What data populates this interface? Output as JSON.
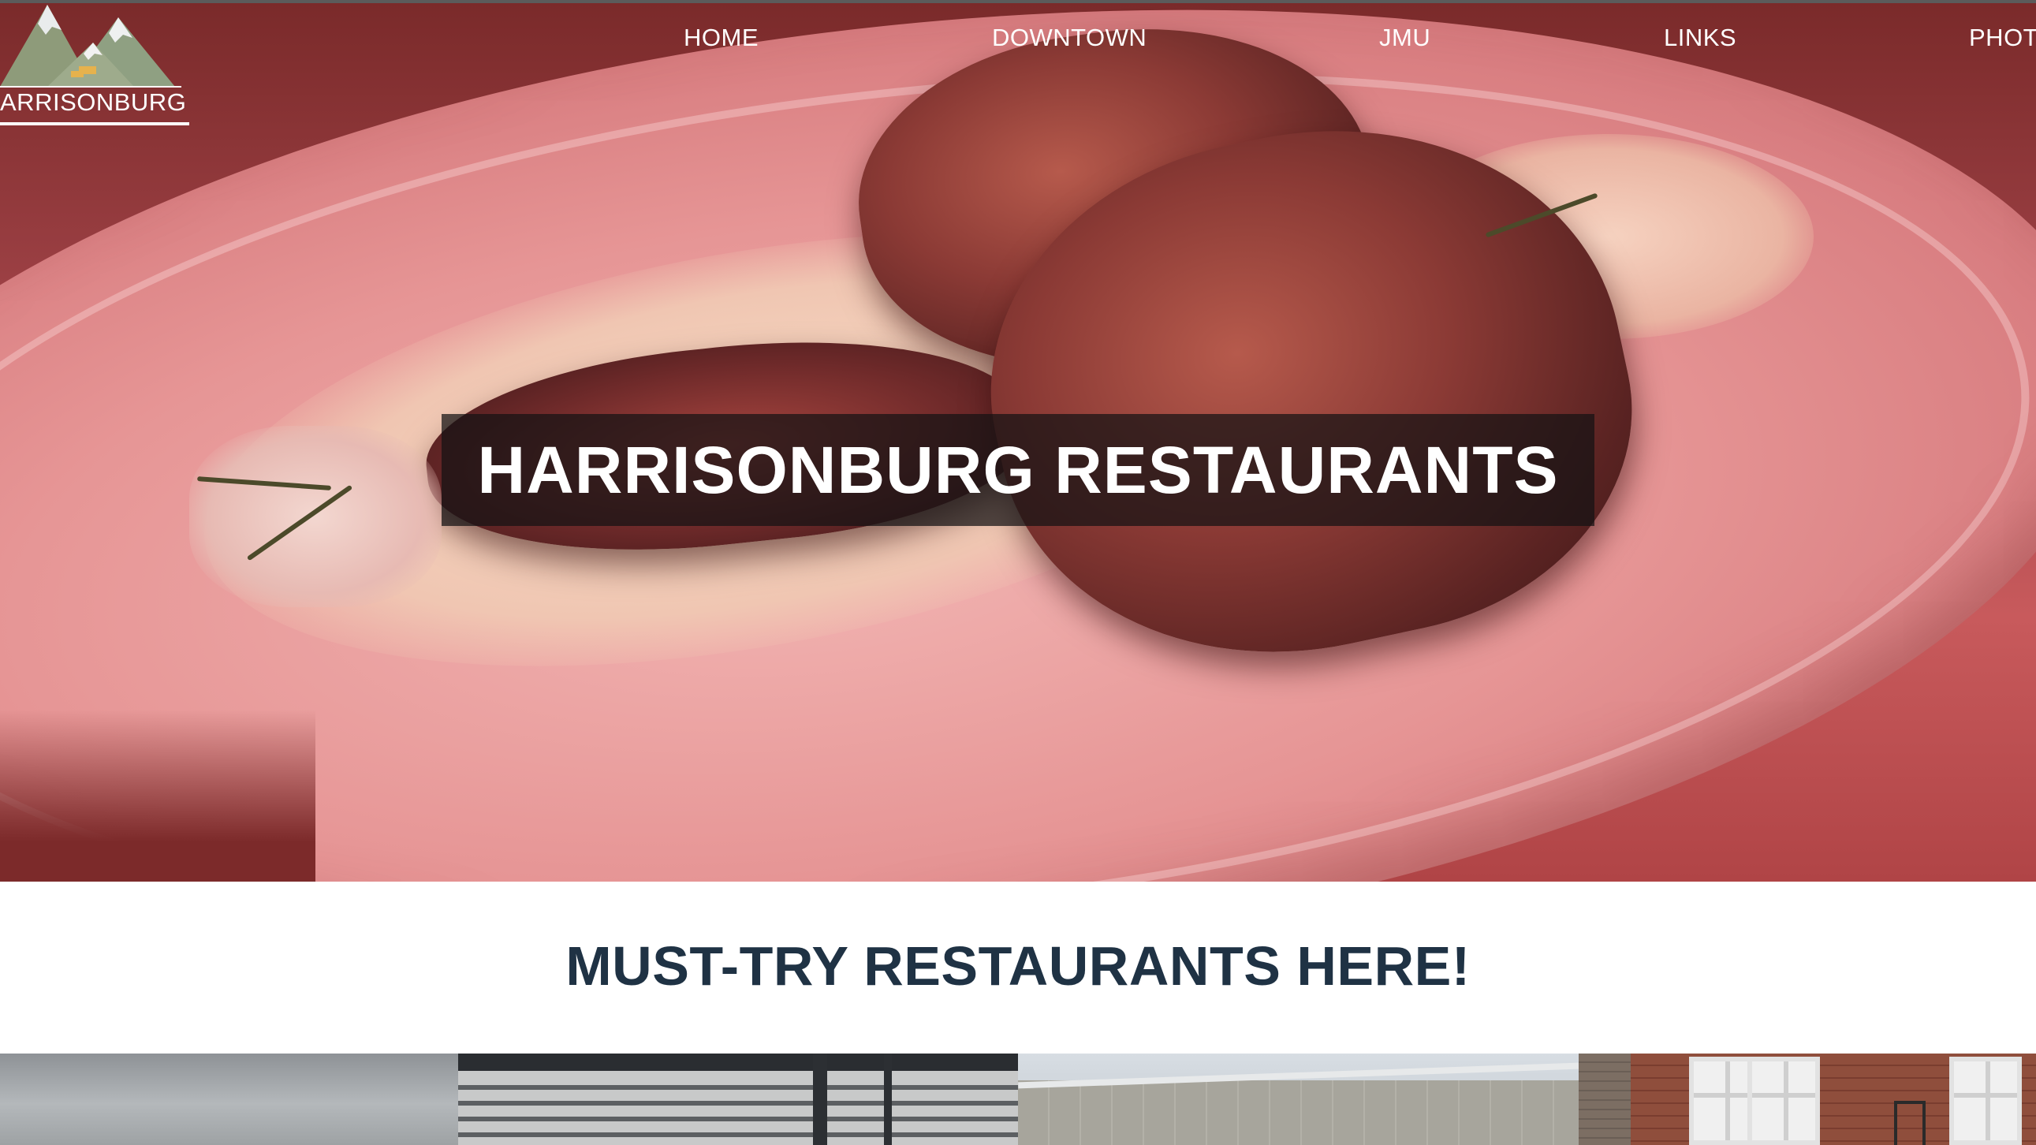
{
  "logo": {
    "text": "ARRISONBURG",
    "icon": "mountains-icon"
  },
  "nav": {
    "items": [
      {
        "label": "HOME"
      },
      {
        "label": "DOWNTOWN"
      },
      {
        "label": "JMU"
      },
      {
        "label": "LINKS"
      },
      {
        "label": "PHOT"
      }
    ]
  },
  "hero": {
    "title": "HARRISONBURG RESTAURANTS",
    "image": "plated-beef-wellington-photo"
  },
  "section": {
    "heading": "MUST-TRY RESTAURANTS HERE!"
  },
  "gallery": {
    "tiles": [
      {
        "image": "cloudy-sky-photo"
      },
      {
        "image": "patio-canopy-photo"
      },
      {
        "image": "building-exterior-photo"
      },
      {
        "image": "brick-storefront-photo"
      }
    ]
  },
  "colors": {
    "heading": "#1f3244",
    "nav_text": "#ffffff",
    "title_box": "#141214"
  }
}
